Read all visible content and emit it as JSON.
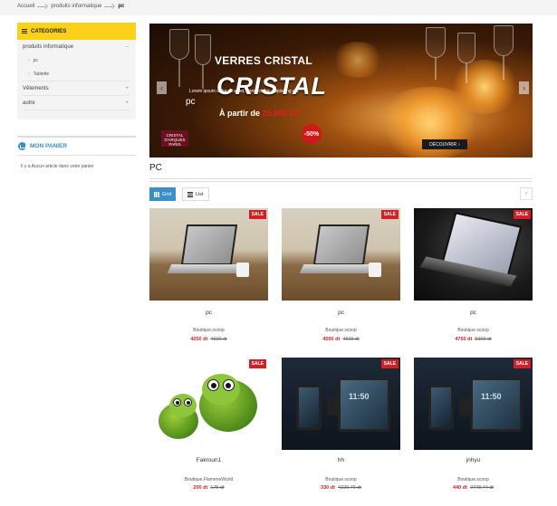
{
  "breadcrumb": {
    "items": [
      "Accueil",
      "produits informatique"
    ],
    "current": "pc"
  },
  "sidebar": {
    "categories_title": "CATEGORIES",
    "categories": [
      {
        "label": "produits informatique",
        "toggle": "–",
        "children": [
          "pc",
          "Tablette"
        ]
      },
      {
        "label": "Vêtements",
        "toggle": "+",
        "children": []
      },
      {
        "label": "autre",
        "toggle": "+",
        "children": []
      }
    ],
    "cart_title": "MON PANIER",
    "cart_empty": "Il y a Aucun article dans votre panier"
  },
  "banner": {
    "headline": "VERRES CRISTAL",
    "big_text": "CRISTAL",
    "price_prefix": "À partir de",
    "price_value": "25,000 DT",
    "discount": "-50%",
    "slide_label": "pc",
    "slide_sub": "Lorem ipsum dolor sit amet, consectetur adipiscing elit",
    "brand": "CRISTAL D'ARQUES PARIS",
    "cta": "DÉCOUVRIR",
    "cta_icon": "chevron-right-icon",
    "prev_icon": "chevron-left-icon",
    "next_icon": "chevron-right-icon"
  },
  "page": {
    "title": "PC"
  },
  "view": {
    "grid_label": "Grid",
    "list_label": "List",
    "active": "grid",
    "scroll_top_icon": "arrow-up-icon"
  },
  "products": [
    {
      "name": "pc",
      "shop": "Boutique.scoop",
      "price": "4250 dt",
      "old_price": "4600 dt",
      "badge": "SALE",
      "image": "laptop-desk"
    },
    {
      "name": "pc",
      "shop": "Boutique.scoop",
      "price": "4000 dt",
      "old_price": "4600 dt",
      "badge": "SALE",
      "image": "laptop-desk"
    },
    {
      "name": "pc",
      "shop": "Boutique.scoop",
      "price": "4750 dt",
      "old_price": "5000 dt",
      "badge": "SALE",
      "image": "laptop-dark"
    },
    {
      "name": "Fakroun1",
      "shop": "Boutique.FlameneWorld",
      "price": "200 dt",
      "old_price": "175 dt",
      "badge": "SALE",
      "image": "turtle-plush"
    },
    {
      "name": "hh",
      "shop": "Boutique.scoop",
      "price": "330 dt",
      "old_price": "4220.76 dt",
      "badge": "SALE",
      "image": "devices"
    },
    {
      "name": "jnhyu",
      "shop": "Boutique.scoop",
      "price": "440 dt",
      "old_price": "2778.44 dt",
      "badge": "SALE",
      "image": "devices"
    }
  ]
}
